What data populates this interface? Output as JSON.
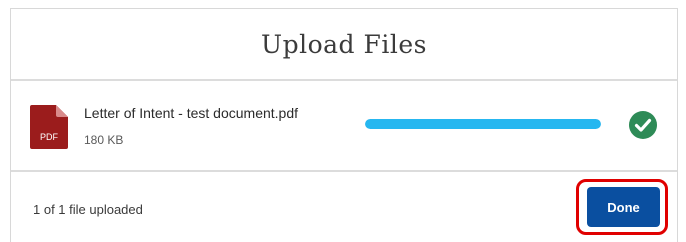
{
  "dialog": {
    "title": "Upload Files"
  },
  "file": {
    "icon": "pdf-file-icon",
    "icon_label": "PDF",
    "name": "Letter of Intent - test document.pdf",
    "size": "180 KB",
    "progress_percent": 100,
    "status_icon": "check-circle-icon"
  },
  "footer": {
    "status_text": "1 of 1 file uploaded",
    "done_label": "Done"
  },
  "colors": {
    "progress": "#26b7f0",
    "success": "#2e8b57",
    "done_button": "#0a4fa0",
    "highlight": "#e00000",
    "pdf_icon": "#9b1c1c"
  }
}
